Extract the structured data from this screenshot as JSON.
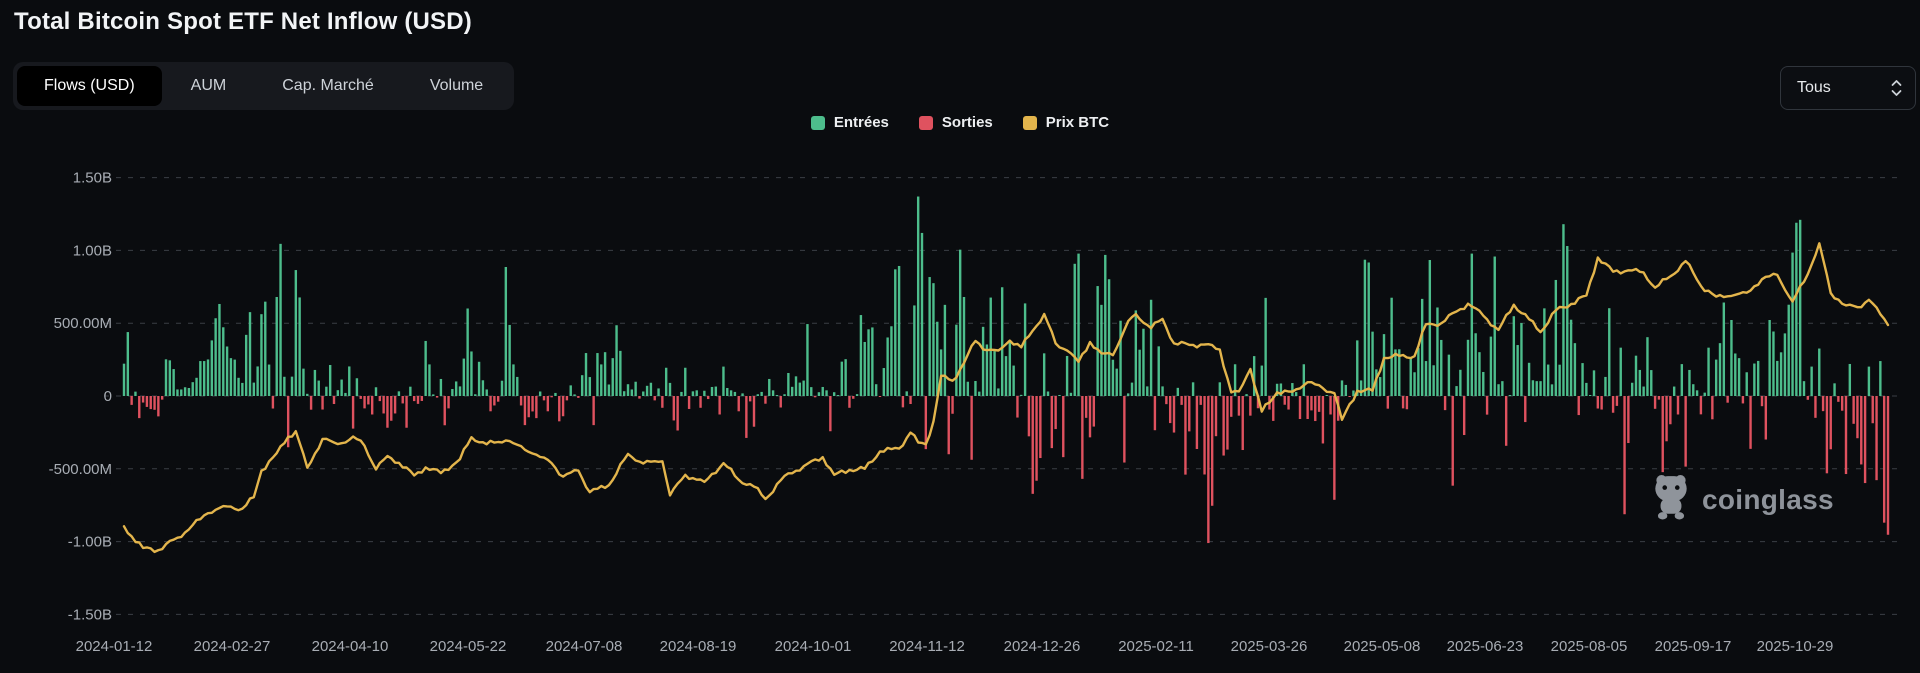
{
  "header": {
    "title": "Total Bitcoin Spot ETF Net Inflow (USD)"
  },
  "tabs": [
    {
      "label": "Flows (USD)",
      "active": true
    },
    {
      "label": "AUM",
      "active": false
    },
    {
      "label": "Cap. Marché",
      "active": false
    },
    {
      "label": "Volume",
      "active": false
    }
  ],
  "controls": {
    "range_value": "Tous"
  },
  "watermark": {
    "text": "coinglass"
  },
  "chart_data": {
    "type": "bar",
    "title": "Total Bitcoin Spot ETF Net Inflow (USD)",
    "legend_position": "top-center",
    "grid": "dashed-horizontal",
    "legend": [
      {
        "label": "Entrées",
        "color": "#4dbd8c"
      },
      {
        "label": "Sorties",
        "color": "#df525f"
      },
      {
        "label": "Prix BTC",
        "color": "#e3b54c"
      }
    ],
    "colors": {
      "inflow": "#4dbd8c",
      "outflow": "#df525f",
      "price": "#e3b54c",
      "grid": "#3a3e45",
      "axis_text": "#a8adb4",
      "background": "#0a0c0f"
    },
    "y_axis": {
      "unit": "USD",
      "tick_labels": [
        "1.50B",
        "1.00B",
        "500.00M",
        "0",
        "-500.00M",
        "-1.00B",
        "-1.50B"
      ],
      "tick_values_m": [
        1500,
        1000,
        500,
        0,
        -500,
        -1000,
        -1500
      ],
      "ylim_m": [
        -1500,
        1500
      ]
    },
    "x_axis": {
      "tick_labels": [
        "2024-01-12",
        "2024-02-27",
        "2024-04-10",
        "2024-05-22",
        "2024-07-08",
        "2024-08-19",
        "2024-10-01",
        "2024-11-12",
        "2024-12-26",
        "2025-02-11",
        "2025-03-26",
        "2025-05-08",
        "2025-06-23",
        "2025-08-05",
        "2025-09-17",
        "2025-10-29"
      ]
    },
    "series": {
      "net_flow_musd": [
        222,
        439,
        -61,
        30,
        -152,
        -45,
        -75,
        -90,
        -95,
        -140,
        -25,
        252,
        245,
        185,
        45,
        45,
        60,
        55,
        95,
        125,
        240,
        240,
        251,
        382,
        534,
        632,
        472,
        340,
        260,
        250,
        125,
        90,
        420,
        576,
        92,
        203,
        562,
        648,
        216,
        -86,
        680,
        1045,
        132,
        -352,
        133,
        865,
        677,
        188,
        15,
        -94,
        179,
        106,
        -93,
        64,
        213,
        -55,
        40,
        113,
        21,
        203,
        -224,
        122,
        -20,
        -85,
        -58,
        -127,
        60,
        -35,
        -120,
        -218,
        -170,
        -120,
        32,
        -51,
        -218,
        64,
        -35,
        -54,
        -34,
        378,
        217,
        11,
        -11,
        117,
        -201,
        -85,
        48,
        100,
        66,
        257,
        601,
        306,
        12,
        235,
        108,
        45,
        -105,
        -65,
        -39,
        105,
        886,
        488,
        217,
        131,
        -65,
        -200,
        -146,
        -106,
        -152,
        31,
        -30,
        -105,
        -9,
        21,
        -174,
        -139,
        -30,
        73,
        11,
        -13,
        143,
        295,
        130,
        -200,
        295,
        217,
        301,
        79,
        260,
        486,
        310,
        33,
        81,
        45,
        98,
        -18,
        31,
        70,
        91,
        -30,
        52,
        -81,
        194,
        90,
        -168,
        -237,
        28,
        194,
        -89,
        32,
        39,
        -81,
        36,
        -21,
        62,
        65,
        -127,
        202,
        55,
        39,
        28,
        -105,
        18,
        -288,
        -37,
        -211,
        12,
        28,
        -53,
        117,
        39,
        2,
        -79,
        12,
        158,
        63,
        135,
        92,
        106,
        494,
        61,
        -9,
        26,
        62,
        39,
        -242,
        26,
        5,
        236,
        253,
        -81,
        -19,
        13,
        556,
        371,
        458,
        471,
        81,
        -4,
        192,
        402,
        479,
        870,
        893,
        -78,
        32,
        -55,
        622,
        1370,
        1120,
        -365,
        817,
        775,
        510,
        320,
        626,
        -400,
        -122,
        490,
        1005,
        680,
        98,
        -438,
        103,
        30,
        475,
        354,
        676,
        308,
        52,
        747,
        274,
        376,
        209,
        -148,
        8,
        636,
        -277,
        -672,
        -582,
        -426,
        293,
        31,
        -358,
        -227,
        5,
        -420,
        275,
        22,
        908,
        978,
        -569,
        -150,
        -284,
        -210,
        755,
        626,
        969,
        802,
        249,
        188,
        517,
        -457,
        18,
        92,
        588,
        318,
        462,
        66,
        661,
        -235,
        341,
        66,
        -56,
        -186,
        -251,
        56,
        -61,
        -540,
        -243,
        94,
        -364,
        -61,
        -539,
        -1010,
        -754,
        -276,
        94,
        -409,
        -368,
        -143,
        218,
        -135,
        -371,
        13,
        -135,
        274,
        -84,
        209,
        674,
        -93,
        -171,
        84,
        86,
        -60,
        -93,
        89,
        27,
        -158,
        218,
        -158,
        -99,
        -172,
        -109,
        -326,
        1,
        -127,
        -713,
        -170,
        107,
        76,
        -6,
        38,
        382,
        107,
        936,
        917,
        442,
        183,
        130,
        425,
        -87,
        675,
        320,
        321,
        -85,
        -91,
        260,
        163,
        329,
        667,
        240,
        934,
        211,
        608,
        385,
        -97,
        284,
        -616,
        68,
        180,
        -268,
        386,
        978,
        431,
        301,
        165,
        -128,
        408,
        958,
        81,
        102,
        -342,
        6,
        548,
        350,
        501,
        -179,
        228,
        108,
        102,
        102,
        602,
        216,
        80,
        797,
        215,
        1180,
        1030,
        524,
        363,
        -131,
        226,
        90,
        2,
        176,
        -86,
        -93,
        131,
        603,
        -115,
        -68,
        332,
        -812,
        -323,
        91,
        277,
        179,
        65,
        404,
        178,
        -88,
        -25,
        -523,
        -311,
        -194,
        65,
        -127,
        219,
        -485,
        179,
        81,
        39,
        -126,
        23,
        332,
        -160,
        250,
        363,
        642,
        -46,
        522,
        292,
        260,
        -51,
        163,
        -363,
        223,
        241,
        -70,
        -299,
        522,
        443,
        241,
        300,
        430,
        627,
        985,
        1190,
        1210,
        102,
        -26,
        202,
        -150,
        326,
        -104,
        -531,
        -366,
        87,
        -40,
        -101,
        -536,
        220,
        -191,
        -290,
        -470,
        -598,
        202,
        -187,
        -578,
        240,
        -870,
        -953
      ],
      "btc_price_kusd_keyframes": [
        [
          0,
          46.3
        ],
        [
          2,
          43.5
        ],
        [
          5,
          40.2
        ],
        [
          9,
          39.6
        ],
        [
          14,
          43.1
        ],
        [
          22,
          50.0
        ],
        [
          26,
          52.0
        ],
        [
          31,
          51.3
        ],
        [
          34,
          54.5
        ],
        [
          36,
          62.0
        ],
        [
          40,
          66.9
        ],
        [
          43,
          71.5
        ],
        [
          45,
          73.1
        ],
        [
          48,
          62.8
        ],
        [
          52,
          70.9
        ],
        [
          55,
          69.9
        ],
        [
          57,
          69.7
        ],
        [
          60,
          71.6
        ],
        [
          63,
          69.0
        ],
        [
          66,
          62.3
        ],
        [
          69,
          66.1
        ],
        [
          72,
          64.2
        ],
        [
          76,
          60.6
        ],
        [
          79,
          62.9
        ],
        [
          83,
          61.3
        ],
        [
          88,
          65.2
        ],
        [
          91,
          71.4
        ],
        [
          95,
          69.4
        ],
        [
          100,
          70.5
        ],
        [
          103,
          69.3
        ],
        [
          107,
          66.8
        ],
        [
          112,
          64.1
        ],
        [
          115,
          60.3
        ],
        [
          119,
          62.0
        ],
        [
          122,
          55.9
        ],
        [
          127,
          57.9
        ],
        [
          132,
          66.7
        ],
        [
          136,
          64.0
        ],
        [
          141,
          64.6
        ],
        [
          143,
          55.0
        ],
        [
          147,
          60.8
        ],
        [
          152,
          58.8
        ],
        [
          157,
          64.1
        ],
        [
          161,
          59.4
        ],
        [
          165,
          57.5
        ],
        [
          168,
          54.0
        ],
        [
          173,
          60.5
        ],
        [
          178,
          63.2
        ],
        [
          183,
          65.8
        ],
        [
          186,
          60.8
        ],
        [
          190,
          62.2
        ],
        [
          194,
          62.5
        ],
        [
          198,
          67.4
        ],
        [
          203,
          68.2
        ],
        [
          206,
          72.7
        ],
        [
          208,
          69.9
        ],
        [
          210,
          69.4
        ],
        [
          212,
          75.9
        ],
        [
          214,
          88.7
        ],
        [
          217,
          87.3
        ],
        [
          220,
          92.3
        ],
        [
          223,
          98.5
        ],
        [
          226,
          95.9
        ],
        [
          229,
          95.8
        ],
        [
          232,
          98.6
        ],
        [
          235,
          96.7
        ],
        [
          238,
          101.4
        ],
        [
          241,
          106.1
        ],
        [
          244,
          97.8
        ],
        [
          247,
          95.8
        ],
        [
          250,
          92.6
        ],
        [
          253,
          98.2
        ],
        [
          256,
          95.0
        ],
        [
          259,
          94.5
        ],
        [
          263,
          104.1
        ],
        [
          265,
          106.1
        ],
        [
          269,
          102.1
        ],
        [
          272,
          104.7
        ],
        [
          275,
          97.8
        ],
        [
          279,
          97.4
        ],
        [
          283,
          97.5
        ],
        [
          287,
          96.1
        ],
        [
          290,
          84.0
        ],
        [
          292,
          84.3
        ],
        [
          295,
          90.6
        ],
        [
          298,
          78.6
        ],
        [
          302,
          84.0
        ],
        [
          306,
          84.2
        ],
        [
          310,
          86.9
        ],
        [
          314,
          85.2
        ],
        [
          317,
          83.8
        ],
        [
          319,
          76.3
        ],
        [
          323,
          84.5
        ],
        [
          327,
          84.5
        ],
        [
          330,
          93.7
        ],
        [
          334,
          94.3
        ],
        [
          338,
          94.2
        ],
        [
          341,
          103.2
        ],
        [
          345,
          103.5
        ],
        [
          349,
          106.8
        ],
        [
          352,
          109.0
        ],
        [
          356,
          105.6
        ],
        [
          360,
          101.6
        ],
        [
          364,
          108.7
        ],
        [
          368,
          104.6
        ],
        [
          371,
          101.0
        ],
        [
          375,
          107.1
        ],
        [
          379,
          108.9
        ],
        [
          383,
          111.3
        ],
        [
          386,
          122.0
        ],
        [
          390,
          118.0
        ],
        [
          394,
          118.4
        ],
        [
          398,
          117.8
        ],
        [
          401,
          113.5
        ],
        [
          405,
          116.7
        ],
        [
          409,
          121.0
        ],
        [
          413,
          114.0
        ],
        [
          417,
          111.0
        ],
        [
          421,
          111.2
        ],
        [
          425,
          112.1
        ],
        [
          429,
          115.9
        ],
        [
          433,
          117.1
        ],
        [
          437,
          109.6
        ],
        [
          441,
          117.3
        ],
        [
          444,
          126.0
        ],
        [
          447,
          112.0
        ],
        [
          451,
          108.5
        ],
        [
          454,
          108.0
        ],
        [
          457,
          110.1
        ],
        [
          460,
          106.0
        ],
        [
          462,
          103.0
        ]
      ],
      "price_axis_note": "hidden right axis; flow_equiv_M = (priceK - 83) / 41 * 1000"
    }
  }
}
